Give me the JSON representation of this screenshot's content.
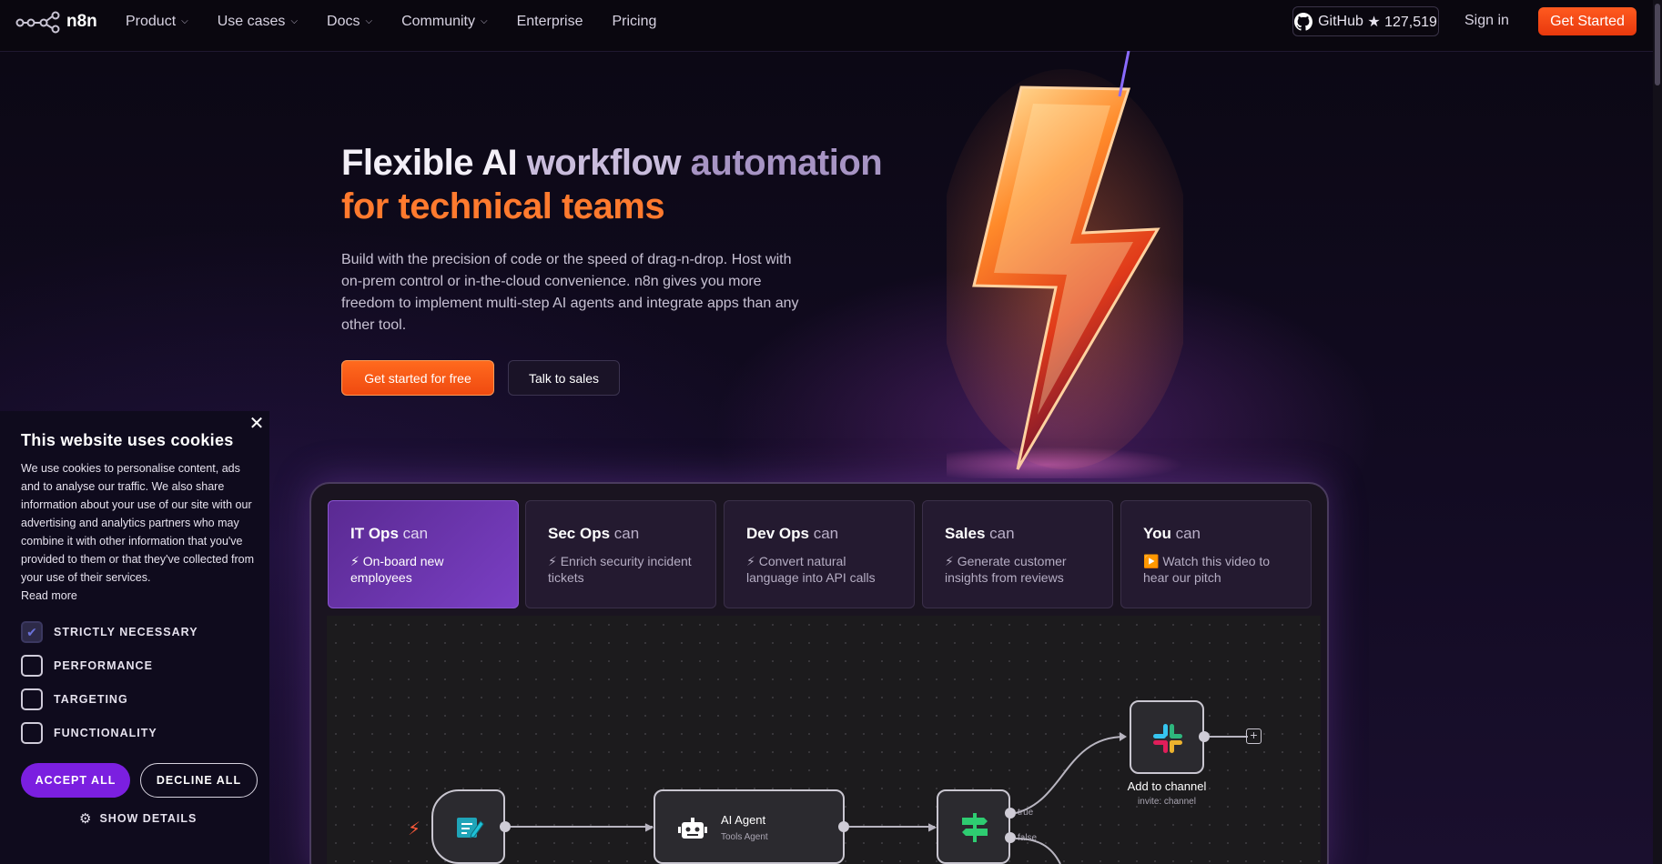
{
  "nav": {
    "logo_text": "n8n",
    "links": [
      {
        "label": "Product",
        "dropdown": true
      },
      {
        "label": "Use cases",
        "dropdown": true
      },
      {
        "label": "Docs",
        "dropdown": true
      },
      {
        "label": "Community",
        "dropdown": true
      },
      {
        "label": "Enterprise",
        "dropdown": false
      },
      {
        "label": "Pricing",
        "dropdown": false
      }
    ],
    "github_label": "GitHub",
    "github_stars": "★ 127,519",
    "signin": "Sign in",
    "get_started": "Get Started"
  },
  "hero": {
    "title_part1": "Flexible AI",
    "title_part2": " workflow",
    "title_part3": " automation",
    "title_line2": "for technical teams",
    "description": "Build with the precision of code or the speed of drag-n-drop. Host with on-prem control or in-the-cloud convenience. n8n gives you more freedom to implement multi-step AI agents and integrate apps than any other tool.",
    "cta_primary": "Get started for free",
    "cta_secondary": "Talk to sales"
  },
  "tabs": [
    {
      "role": "IT Ops",
      "can": " can",
      "desc": "⚡ On-board new employees",
      "active": true
    },
    {
      "role": "Sec Ops",
      "can": " can",
      "desc": "⚡ Enrich security incident tickets",
      "active": false
    },
    {
      "role": "Dev Ops",
      "can": " can",
      "desc": "⚡ Convert natural language into API calls",
      "active": false
    },
    {
      "role": "Sales",
      "can": " can",
      "desc": "⚡ Generate customer insights from reviews",
      "active": false
    },
    {
      "role": "You",
      "can": " can",
      "desc": "▶️ Watch this video to hear our pitch",
      "active": false
    }
  ],
  "workflow": {
    "agent_title": "AI Agent",
    "agent_sub": "Tools Agent",
    "branch_true": "true",
    "branch_false": "false",
    "slack_title": "Add to channel",
    "slack_sub": "invite: channel"
  },
  "cookie": {
    "title": "This website uses cookies",
    "close_symbol": "✕",
    "text": "We use cookies to personalise content, ads and to analyse our traffic. We also share information about your use of our site with our advertising and analytics partners who may combine it with other information that you've provided to them or that they've collected from your use of their services.",
    "read_more": "Read more",
    "options": [
      {
        "label": "STRICTLY NECESSARY",
        "checked": true
      },
      {
        "label": "PERFORMANCE",
        "checked": false
      },
      {
        "label": "TARGETING",
        "checked": false
      },
      {
        "label": "FUNCTIONALITY",
        "checked": false
      }
    ],
    "accept": "ACCEPT ALL",
    "decline": "DECLINE ALL",
    "show_details": "SHOW DETAILS"
  },
  "colors": {
    "accent_orange": "#ff5a1f",
    "cookie_purple": "#7b1fe0",
    "tab_active": "#6a34ac"
  }
}
